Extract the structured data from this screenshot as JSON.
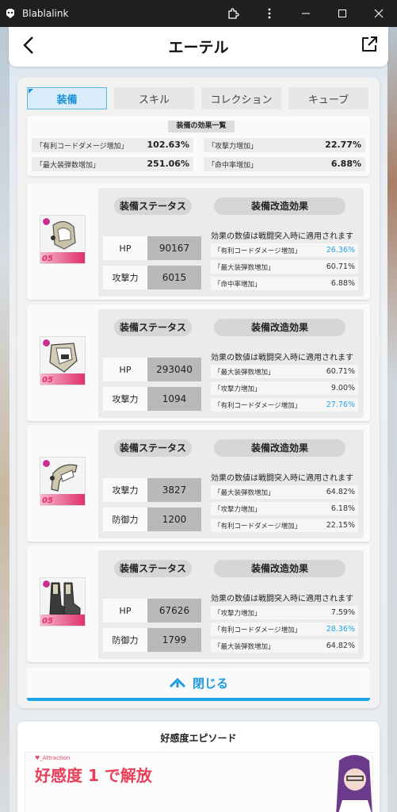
{
  "window": {
    "app_title": "Blablalink"
  },
  "header": {
    "title": "エーテル"
  },
  "tabs": [
    {
      "label": "装備",
      "active": true
    },
    {
      "label": "スキル",
      "active": false
    },
    {
      "label": "コレクション",
      "active": false
    },
    {
      "label": "キューブ",
      "active": false
    }
  ],
  "summary": {
    "title": "装備の効果一覧",
    "stats": [
      {
        "label": "「有利コードダメージ増加」",
        "value": "102.63%"
      },
      {
        "label": "「攻撃力増加」",
        "value": "22.77%"
      },
      {
        "label": "「最大装弾数増加」",
        "value": "251.06%"
      },
      {
        "label": "「命中率増加」",
        "value": "6.88%"
      }
    ]
  },
  "equipment_labels": {
    "status_header": "装備ステータス",
    "mod_header": "装備改造効果",
    "mod_note": "効果の数値は戦闘突入時に適用されます"
  },
  "equipment": [
    {
      "level": "05",
      "stats": [
        {
          "key": "HP",
          "value": "90167"
        },
        {
          "key": "攻撃力",
          "value": "6015"
        }
      ],
      "mods": [
        {
          "label": "「有利コードダメージ増加」",
          "value": "26.36%",
          "max": true
        },
        {
          "label": "「最大装弾数増加」",
          "value": "60.71%",
          "max": false
        },
        {
          "label": "「命中率増加」",
          "value": "6.88%",
          "max": false
        }
      ]
    },
    {
      "level": "05",
      "stats": [
        {
          "key": "HP",
          "value": "293040"
        },
        {
          "key": "攻撃力",
          "value": "1094"
        }
      ],
      "mods": [
        {
          "label": "「最大装弾数増加」",
          "value": "60.71%",
          "max": false
        },
        {
          "label": "「攻撃力増加」",
          "value": "9.00%",
          "max": false
        },
        {
          "label": "「有利コードダメージ増加」",
          "value": "27.76%",
          "max": true
        }
      ]
    },
    {
      "level": "05",
      "stats": [
        {
          "key": "攻撃力",
          "value": "3827"
        },
        {
          "key": "防御力",
          "value": "1200"
        }
      ],
      "mods": [
        {
          "label": "「最大装弾数増加」",
          "value": "64.82%",
          "max": false
        },
        {
          "label": "「攻撃力増加」",
          "value": "6.18%",
          "max": false
        },
        {
          "label": "「有利コードダメージ増加」",
          "value": "22.15%",
          "max": false
        }
      ]
    },
    {
      "level": "05",
      "stats": [
        {
          "key": "HP",
          "value": "67626"
        },
        {
          "key": "防御力",
          "value": "1799"
        }
      ],
      "mods": [
        {
          "label": "「攻撃力増加」",
          "value": "7.59%",
          "max": false
        },
        {
          "label": "「有利コードダメージ増加」",
          "value": "28.36%",
          "max": true
        },
        {
          "label": "「最大装弾数増加」",
          "value": "64.82%",
          "max": false
        }
      ]
    }
  ],
  "close_bar": {
    "label": "閉じる"
  },
  "affection": {
    "title": "好感度エピソード",
    "tag": "♥_Attraction",
    "unlock_text": "好感度 1 で解放"
  },
  "colors": {
    "accent": "#1fa4ea",
    "max_value": "#29a3e6",
    "unlock": "#e8405a",
    "rarity": "#c6338d"
  },
  "icons": [
    "app-logo-icon",
    "extensions-icon",
    "more-vert-icon",
    "minimize-icon",
    "maximize-icon",
    "close-icon",
    "back-arrow-icon",
    "external-link-icon",
    "collapse-chevron-icon"
  ]
}
